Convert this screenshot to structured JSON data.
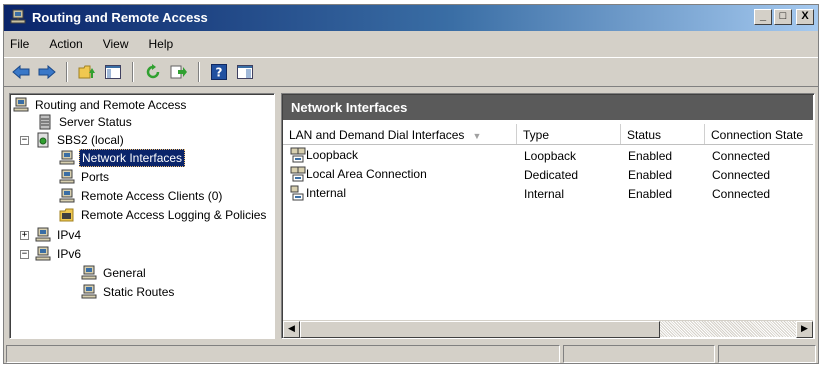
{
  "window": {
    "title": "Routing and Remote Access",
    "accent": "#0a246a"
  },
  "titlebar_buttons": {
    "minimize": "_",
    "maximize": "□",
    "close": "X"
  },
  "menu": [
    "File",
    "Action",
    "View",
    "Help"
  ],
  "toolbar": [
    "back-icon",
    "forward-icon",
    "up-folder-icon",
    "show-hide-tree-icon",
    "refresh-icon",
    "export-list-icon",
    "help-icon",
    "properties-view-icon"
  ],
  "tree": {
    "root": "Routing and Remote Access",
    "server_status": "Server Status",
    "server": "SBS2 (local)",
    "network_interfaces": "Network Interfaces",
    "ports": "Ports",
    "remote_access_clients": "Remote Access Clients (0)",
    "logging_policies": "Remote Access Logging & Policies",
    "ipv4": "IPv4",
    "ipv6": "IPv6",
    "general": "General",
    "static_routes": "Static Routes",
    "expanders": {
      "server": "−",
      "ipv4": "+",
      "ipv6": "−"
    }
  },
  "details": {
    "title": "Network Interfaces",
    "columns": [
      "LAN and Demand Dial Interfaces",
      "Type",
      "Status",
      "Connection State"
    ],
    "sort_indicator": "▼",
    "rows": [
      [
        "Loopback",
        "Loopback",
        "Enabled",
        "Connected"
      ],
      [
        "Local Area Connection",
        "Dedicated",
        "Enabled",
        "Connected"
      ],
      [
        "Internal",
        "Internal",
        "Enabled",
        "Connected"
      ]
    ]
  },
  "scrollbar": {
    "left": "◀",
    "right": "▶"
  }
}
